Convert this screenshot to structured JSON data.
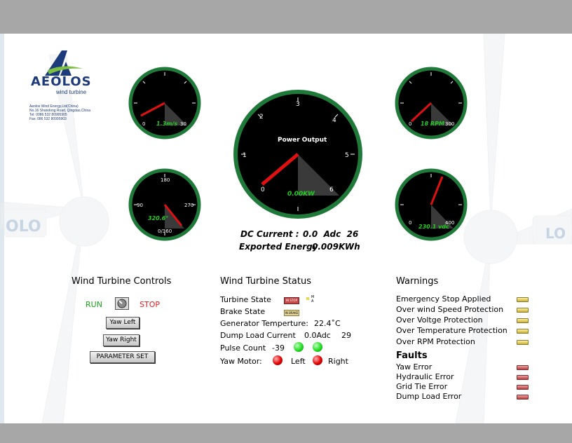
{
  "company": {
    "logo_text": "AEOLOS",
    "logo_sub": "wind turbine",
    "info": [
      "Aeolos Wind Energy,Ltd(China)",
      "No.16 Shandong Road, Qingdao,China",
      "Tel: 0086 532 80995905",
      "Fax: 086 532 80995903"
    ]
  },
  "gauges": {
    "wind_speed": {
      "min": "0",
      "max": "30",
      "value": "1.3m/s"
    },
    "direction": {
      "top": "180",
      "left": "90",
      "right": "270",
      "bottom": "0/360",
      "value": "320.6°"
    },
    "power": {
      "title": "Power Output",
      "ticks": [
        "0",
        "1",
        "2",
        "3",
        "4",
        "5",
        "6"
      ],
      "value": "0.00KW"
    },
    "rpm": {
      "min": "0",
      "max": "300",
      "value": "18 RPM"
    },
    "voltage": {
      "min": "0",
      "max": "400",
      "value": "230.1 vdc"
    }
  },
  "readouts": {
    "dc_current_label": "DC Current :",
    "dc_current_value": "0.0  Adc  26",
    "energy_label": "Exported Energy",
    "energy_value": "0.009KWh"
  },
  "controls": {
    "title": "Wind Turbine Controls",
    "run": "RUN",
    "stop": "STOP",
    "yaw_left": "Yaw Left",
    "yaw_right": "Yaw Right",
    "parameter_set": "PARAMETER SET"
  },
  "status": {
    "title": "Wind Turbine Status",
    "turbine_state": "Turbine State",
    "turbine_indicator": "IN STOP",
    "mode_letters": "M A",
    "brake_state": "Brake State",
    "brake_indicator": "IN BRAKE",
    "generator_label": "Generator Temperture:",
    "generator_value": "22.4˚C",
    "dump_label": "Dump Load Current",
    "dump_value": "0.0Adc",
    "dump_extra": "29",
    "pulse_label": "Pulse Count",
    "pulse_value": "-39",
    "yaw_label": "Yaw Motor:",
    "yaw_left": "Left",
    "yaw_right": "Right"
  },
  "warnings": {
    "title": "Warnings",
    "items": [
      "Emergency Stop Applied",
      "Over wind Speed Protection",
      "Over Voltge Protection",
      "Over Temperature Protection",
      "Over  RPM Protection"
    ]
  },
  "faults": {
    "title": "Faults",
    "items": [
      "Yaw Error",
      "Hydraulic  Error",
      "Grid Tie  Error",
      "Dump Load  Error"
    ]
  },
  "colors": {
    "gauge_ring": "#1f7a3a",
    "needle": "#e01010",
    "digital": "#22cc22",
    "run": "#1aa31a",
    "stop": "#e02020",
    "led_green": "#22dd22",
    "led_red": "#e00000"
  }
}
